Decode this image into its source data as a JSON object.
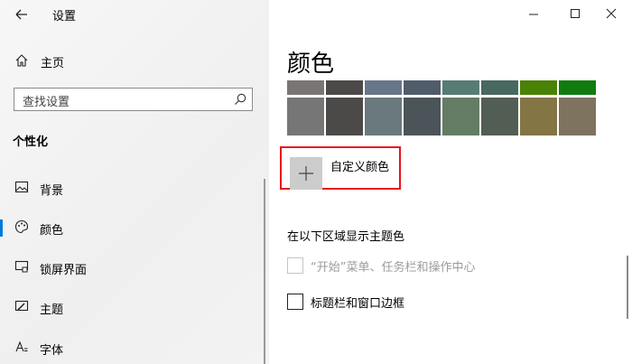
{
  "app": {
    "title": "设置"
  },
  "sidebar": {
    "home_label": "主页",
    "search_placeholder": "查找设置",
    "section_title": "个性化",
    "items": [
      {
        "label": "背景",
        "icon": "image-icon"
      },
      {
        "label": "颜色",
        "icon": "palette-icon",
        "active": true
      },
      {
        "label": "锁屏界面",
        "icon": "lock-screen-icon"
      },
      {
        "label": "主题",
        "icon": "theme-icon"
      },
      {
        "label": "字体",
        "icon": "font-icon"
      }
    ]
  },
  "main": {
    "title": "颜色",
    "swatch_colors_row1": [
      "#7a7574",
      "#4c4a48",
      "#68768a",
      "#515c6b",
      "#567c73",
      "#486860",
      "#498205",
      "#107c10"
    ],
    "swatch_colors_row2": [
      "#767676",
      "#4c4a48",
      "#69797e",
      "#4a5459",
      "#647c64",
      "#525e54",
      "#847545",
      "#7e735f"
    ],
    "custom_color_label": "自定义颜色",
    "accent_section_title": "在以下区域显示主题色",
    "options": [
      {
        "label": "“开始”菜单、任务栏和操作中心",
        "checked": false,
        "disabled": true
      },
      {
        "label": "标题栏和窗口边框",
        "checked": false,
        "disabled": false
      }
    ]
  },
  "colors": {
    "accent": "#0078d7",
    "highlight_border": "#e8141b"
  }
}
